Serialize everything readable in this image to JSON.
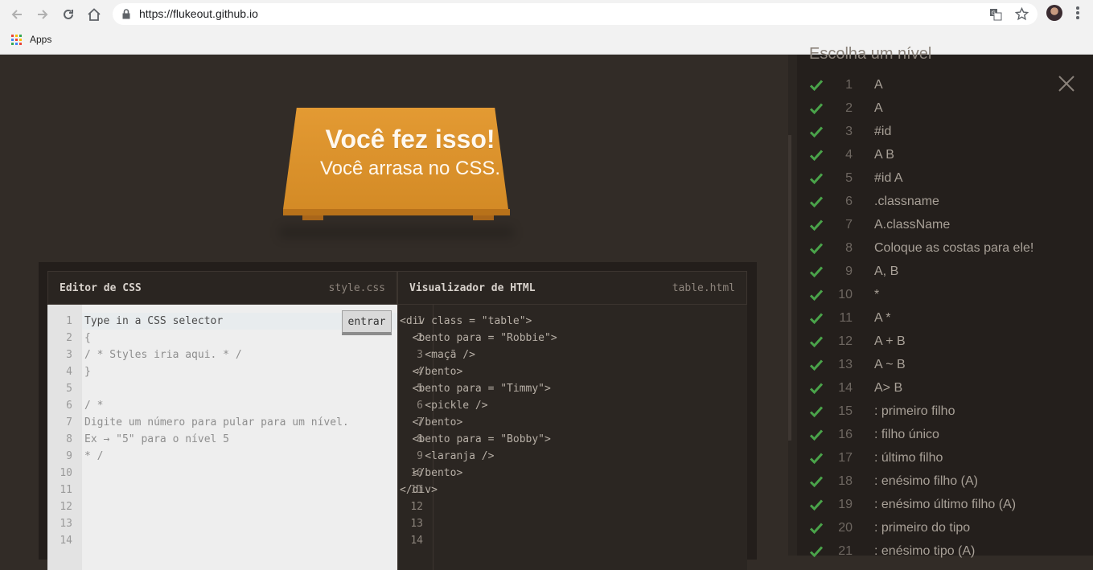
{
  "browser": {
    "url": "https://flukeout.github.io",
    "bookmarks": [
      {
        "label": "Apps"
      }
    ]
  },
  "banner": {
    "title": "Você fez isso!",
    "subtitle": "Você arrasa no CSS."
  },
  "css_editor": {
    "title": "Editor de CSS",
    "file": "style.css",
    "input_placeholder": "Type in a CSS selector",
    "enter_label": "entrar",
    "line_numbers": [
      "1",
      "2",
      "3",
      "4",
      "5",
      "6",
      "7",
      "8",
      "9",
      "10",
      "11",
      "12",
      "13",
      "14"
    ],
    "lines": [
      "Type in a CSS selector",
      "{",
      "/ * Styles iria aqui. * /",
      "}",
      "",
      "/ *",
      "Digite um número para pular para um nível.",
      "Ex → \"5\" para o nível 5",
      "* /"
    ]
  },
  "html_viewer": {
    "title": "Visualizador de HTML",
    "file": "table.html",
    "line_numbers": [
      "1",
      "2",
      "3",
      "4",
      "5",
      "6",
      "7",
      "8",
      "9",
      "10",
      "11",
      "12",
      "13",
      "14"
    ],
    "lines": [
      "<div class = \"table\">",
      "  <bento para = \"Robbie\">",
      "    <maçã />",
      "  </bento>",
      "  <bento para = \"Timmy\">",
      "    <pickle />",
      "  </bento>",
      "  <bento para = \"Bobby\">",
      "    <laranja />",
      "  </bento>",
      "</div>"
    ]
  },
  "level_menu": {
    "title": "Escolha um nível",
    "check_color": "#4aa34a",
    "levels": [
      {
        "num": "1",
        "name": "A"
      },
      {
        "num": "2",
        "name": "A"
      },
      {
        "num": "3",
        "name": "#id"
      },
      {
        "num": "4",
        "name": "A B"
      },
      {
        "num": "5",
        "name": "#id A"
      },
      {
        "num": "6",
        "name": ".classname"
      },
      {
        "num": "7",
        "name": "A.className"
      },
      {
        "num": "8",
        "name": "Coloque as costas para ele!"
      },
      {
        "num": "9",
        "name": "A, B"
      },
      {
        "num": "10",
        "name": "*"
      },
      {
        "num": "11",
        "name": "A *"
      },
      {
        "num": "12",
        "name": "A + B"
      },
      {
        "num": "13",
        "name": "A ~ B"
      },
      {
        "num": "14",
        "name": "A> B"
      },
      {
        "num": "15",
        "name": ": primeiro filho"
      },
      {
        "num": "16",
        "name": ": filho único"
      },
      {
        "num": "17",
        "name": ": último filho"
      },
      {
        "num": "18",
        "name": ": enésimo filho (A)"
      },
      {
        "num": "19",
        "name": ": enésimo último filho (A)"
      },
      {
        "num": "20",
        "name": ": primeiro do tipo"
      },
      {
        "num": "21",
        "name": ": enésimo tipo (A)"
      }
    ]
  }
}
